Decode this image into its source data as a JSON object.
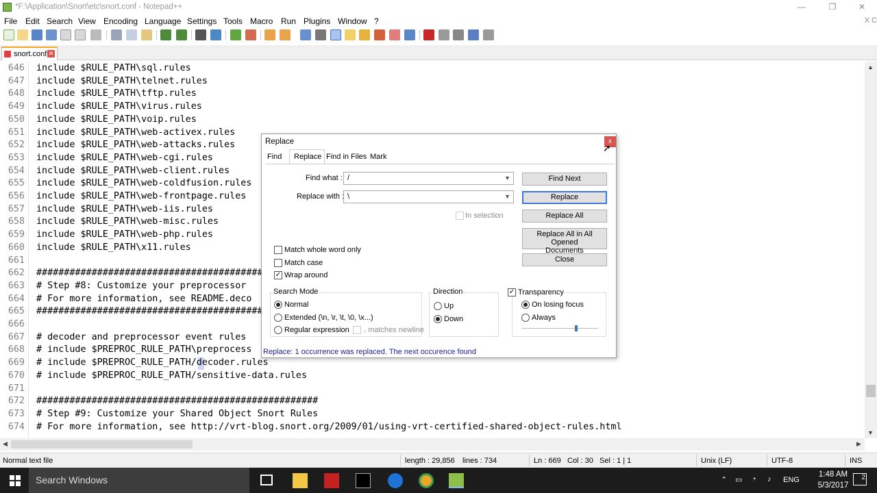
{
  "window": {
    "title": "*F:\\Application\\Snort\\etc\\snort.conf - Notepad++",
    "minimize_icon": "—",
    "restore_icon": "❐",
    "close_icon": "✕"
  },
  "menu": {
    "items": [
      "File",
      "Edit",
      "Search",
      "View",
      "Encoding",
      "Language",
      "Settings",
      "Tools",
      "Macro",
      "Run",
      "Plugins",
      "Window",
      "?"
    ],
    "doc_close": "X C"
  },
  "tab": {
    "label": "snort.conf",
    "close": "✕"
  },
  "editor": {
    "lines": [
      {
        "n": "646",
        "text": "include $RULE_PATH\\sql.rules"
      },
      {
        "n": "647",
        "text": "include $RULE_PATH\\telnet.rules"
      },
      {
        "n": "648",
        "text": "include $RULE_PATH\\tftp.rules"
      },
      {
        "n": "649",
        "text": "include $RULE_PATH\\virus.rules"
      },
      {
        "n": "650",
        "text": "include $RULE_PATH\\voip.rules"
      },
      {
        "n": "651",
        "text": "include $RULE_PATH\\web-activex.rules"
      },
      {
        "n": "652",
        "text": "include $RULE_PATH\\web-attacks.rules"
      },
      {
        "n": "653",
        "text": "include $RULE_PATH\\web-cgi.rules"
      },
      {
        "n": "654",
        "text": "include $RULE_PATH\\web-client.rules"
      },
      {
        "n": "655",
        "text": "include $RULE_PATH\\web-coldfusion.rules"
      },
      {
        "n": "656",
        "text": "include $RULE_PATH\\web-frontpage.rules"
      },
      {
        "n": "657",
        "text": "include $RULE_PATH\\web-iis.rules"
      },
      {
        "n": "658",
        "text": "include $RULE_PATH\\web-misc.rules"
      },
      {
        "n": "659",
        "text": "include $RULE_PATH\\web-php.rules"
      },
      {
        "n": "660",
        "text": "include $RULE_PATH\\x11.rules"
      },
      {
        "n": "661",
        "text": ""
      },
      {
        "n": "662",
        "text": "###################################################"
      },
      {
        "n": "663",
        "text": "# Step #8: Customize your preprocessor"
      },
      {
        "n": "664",
        "text": "# For more information, see README.deco"
      },
      {
        "n": "665",
        "text": "###################################################"
      },
      {
        "n": "666",
        "text": ""
      },
      {
        "n": "667",
        "text": "# decoder and preprocessor event rules"
      },
      {
        "n": "668",
        "text": "# include $PREPROC_RULE_PATH\\preprocess"
      },
      {
        "n": "669",
        "text": "# include $PREPROC_RULE_PATH/decoder.rules"
      },
      {
        "n": "670",
        "text": "# include $PREPROC_RULE_PATH/sensitive-data.rules"
      },
      {
        "n": "671",
        "text": ""
      },
      {
        "n": "672",
        "text": "###################################################"
      },
      {
        "n": "673",
        "text": "# Step #9: Customize your Shared Object Snort Rules"
      },
      {
        "n": "674",
        "text": "# For more information, see http://vrt-blog.snort.org/2009/01/using-vrt-certified-shared-object-rules.html"
      }
    ]
  },
  "status": {
    "file_type": "Normal text file",
    "length": "length : 29,856",
    "lines": "lines : 734",
    "ln": "Ln : 669",
    "col": "Col : 30",
    "sel": "Sel : 1 | 1",
    "eol": "Unix (LF)",
    "encoding": "UTF-8",
    "mode": "INS"
  },
  "dialog": {
    "title": "Replace",
    "close": "x",
    "tabs": [
      "Find",
      "Replace",
      "Find in Files",
      "Mark"
    ],
    "find_label": "Find what :",
    "find_value": "/",
    "replace_label": "Replace with :",
    "replace_value": "\\",
    "in_selection": "In selection",
    "buttons": {
      "find_next": "Find Next",
      "replace": "Replace",
      "replace_all": "Replace All",
      "replace_all_opened_1": "Replace All in All Opened",
      "replace_all_opened_2": "Documents",
      "close": "Close"
    },
    "options": {
      "match_whole_word": "Match whole word only",
      "match_case": "Match case",
      "wrap_around": "Wrap around"
    },
    "search_mode": {
      "label": "Search Mode",
      "normal": "Normal",
      "extended": "Extended (\\n, \\r, \\t, \\0, \\x...)",
      "regex": "Regular expression",
      "matches_newline": ". matches newline"
    },
    "direction": {
      "label": "Direction",
      "up": "Up",
      "down": "Down"
    },
    "transparency": {
      "label": "Transparency",
      "on_losing_focus": "On losing focus",
      "always": "Always",
      "level": 0.7
    },
    "status_message": "Replace: 1 occurrence was replaced. The next occurence found"
  },
  "taskbar": {
    "search_placeholder": "Search Windows",
    "language": "ENG",
    "time": "1:48 AM",
    "date": "5/3/2017",
    "notifications": "2"
  },
  "colors": {
    "accent": "#3d77d6",
    "close_red": "#d9534f",
    "status_blue": "#1a1aa0",
    "taskbar": "#1c1c1c"
  }
}
